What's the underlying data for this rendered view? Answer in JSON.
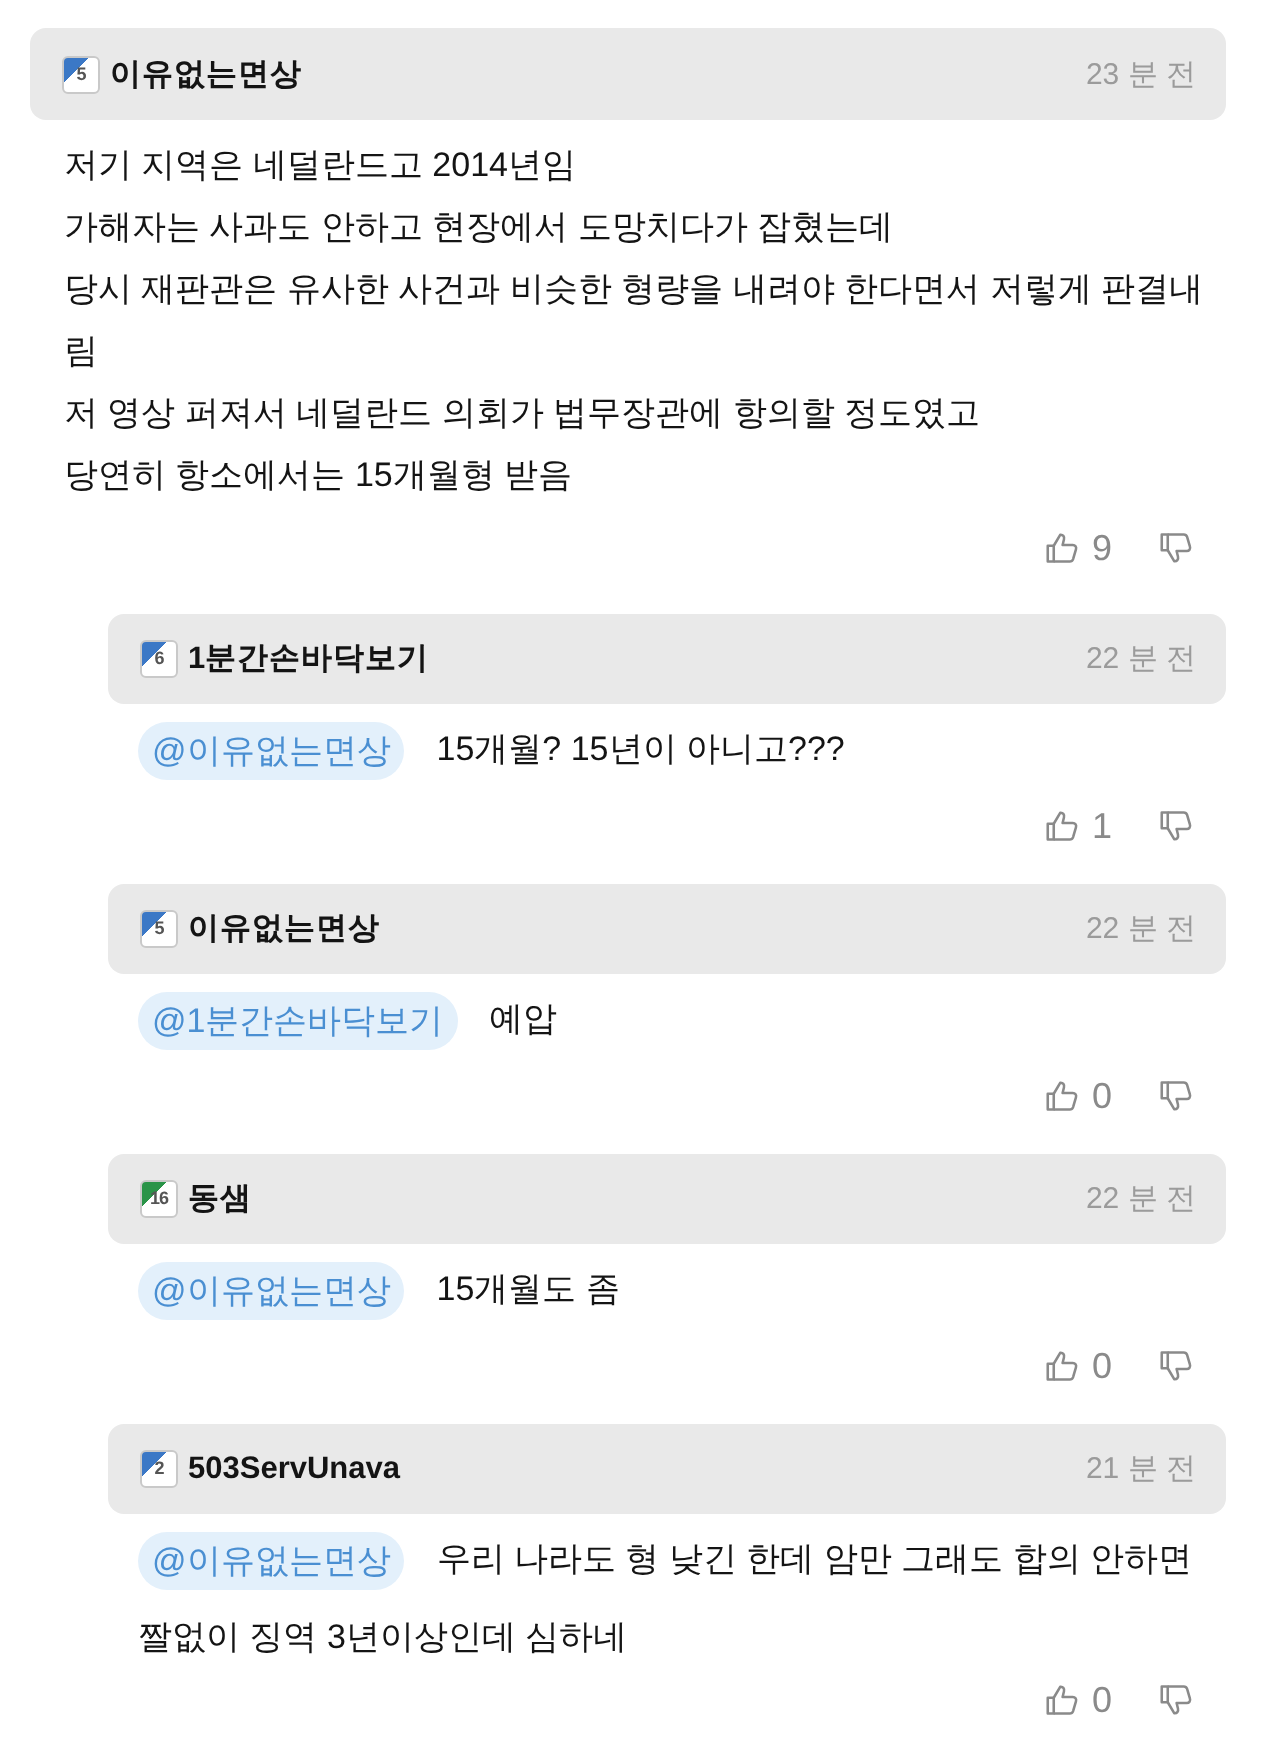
{
  "comments": [
    {
      "author": "이유없는면상",
      "badge": {
        "text": "5",
        "color": "#3b78c6"
      },
      "time": "23 분 전",
      "lines": [
        "저기 지역은 네덜란드고 2014년임",
        "가해자는 사과도 안하고 현장에서 도망치다가 잡혔는데",
        "당시 재판관은 유사한 사건과 비슷한 형량을 내려야 한다면서 저렇게 판결내림",
        "저 영상 퍼져서 네덜란드 의회가 법무장관에 항의할 정도였고",
        "당연히 항소에서는 15개월형 받음"
      ],
      "likes": "9",
      "replies": [
        {
          "author": "1분간손바닥보기",
          "badge": {
            "text": "6",
            "color": "#3b78c6"
          },
          "time": "22 분 전",
          "mention": "@이유없는면상",
          "lines": [
            "15개월? 15년이 아니고???"
          ],
          "likes": "1"
        },
        {
          "author": "이유없는면상",
          "badge": {
            "text": "5",
            "color": "#3b78c6"
          },
          "time": "22 분 전",
          "mention": "@1분간손바닥보기",
          "lines": [
            "예압"
          ],
          "likes": "0"
        },
        {
          "author": "동샘",
          "badge": {
            "text": "16",
            "color": "#2a9448"
          },
          "time": "22 분 전",
          "mention": "@이유없는면상",
          "lines": [
            "15개월도 좀"
          ],
          "likes": "0"
        },
        {
          "author": "503ServUnava",
          "badge": {
            "text": "2",
            "color": "#3b78c6"
          },
          "time": "21 분 전",
          "mention": "@이유없는면상",
          "lines": [
            "우리 나라도 형 낮긴 한데 암만 그래도 합의 안하면",
            "짤없이 징역 3년이상인데 심하네"
          ],
          "likes": "0"
        }
      ]
    }
  ]
}
